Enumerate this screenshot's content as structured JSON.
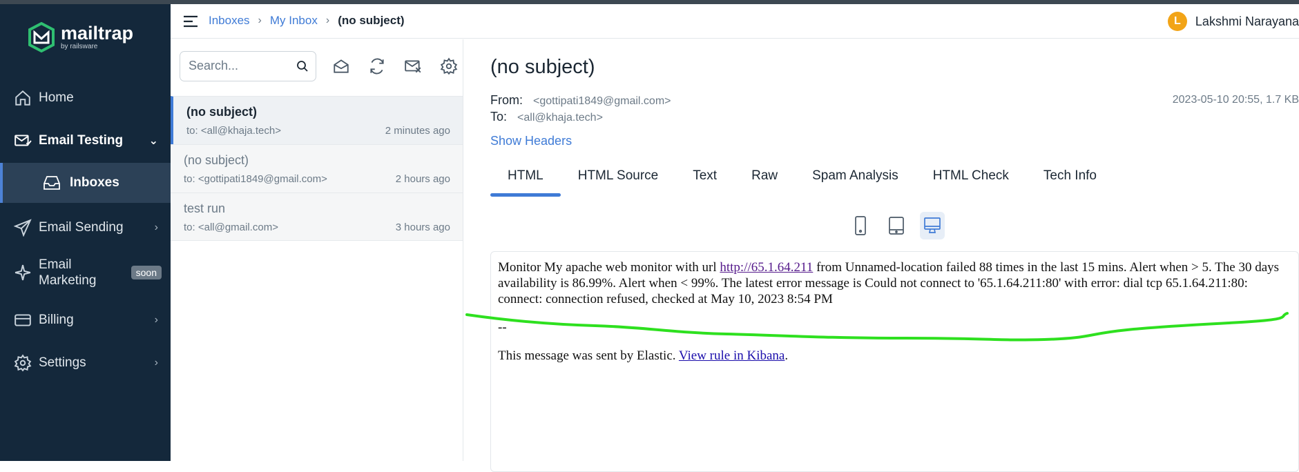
{
  "brand": {
    "name": "mailtrap",
    "sub": "by railsware",
    "accent": "#2fbf71"
  },
  "sidebar": {
    "items": [
      {
        "label": "Home",
        "icon": "home-icon"
      },
      {
        "label": "Email Testing",
        "icon": "email-testing-icon"
      },
      {
        "label": "Email Sending",
        "icon": "send-icon"
      },
      {
        "label": "Email",
        "label2": "Marketing",
        "badge": "soon",
        "icon": "sparkle-icon"
      },
      {
        "label": "Billing",
        "icon": "billing-icon"
      },
      {
        "label": "Settings",
        "icon": "gear-icon"
      }
    ],
    "sub_item": {
      "label": "Inboxes",
      "icon": "inbox-icon"
    }
  },
  "breadcrumb": {
    "crumb1": "Inboxes",
    "crumb2": "My Inbox",
    "current": "(no subject)"
  },
  "user": {
    "initial": "L",
    "name": "Lakshmi Narayana"
  },
  "search": {
    "placeholder": "Search..."
  },
  "messages": [
    {
      "subject": "(no subject)",
      "to": "to: <all@khaja.tech>",
      "time": "2 minutes ago"
    },
    {
      "subject": "(no subject)",
      "to": "to: <gottipati1849@gmail.com>",
      "time": "2 hours ago"
    },
    {
      "subject": "test run",
      "to": "to: <all@gmail.com>",
      "time": "3 hours ago"
    }
  ],
  "detail": {
    "title": "(no subject)",
    "from_label": "From:",
    "from": "<gottipati1849@gmail.com>",
    "to_label": "To:",
    "to": "<all@khaja.tech>",
    "meta": "2023-05-10 20:55, 1.7 KB",
    "show_headers": "Show Headers",
    "tabs": [
      "HTML",
      "HTML Source",
      "Text",
      "Raw",
      "Spam Analysis",
      "HTML Check",
      "Tech Info"
    ],
    "body": {
      "p1_a": "Monitor My apache web monitor with url ",
      "p1_link": "http://65.1.64.211",
      "p1_b": " from Unnamed-location failed 88 times in the last 15 mins. Alert when > 5. The 30 days availability is 86.99%. Alert when < 99%. The latest error message is Could not connect to '65.1.64.211:80' with error: dial tcp 65.1.64.211:80: connect: connection refused, checked at May 10, 2023 8:54 PM",
      "sep": "--",
      "p3_a": "This message was sent by Elastic. ",
      "p3_link": "View rule in Kibana",
      "p3_b": "."
    }
  }
}
